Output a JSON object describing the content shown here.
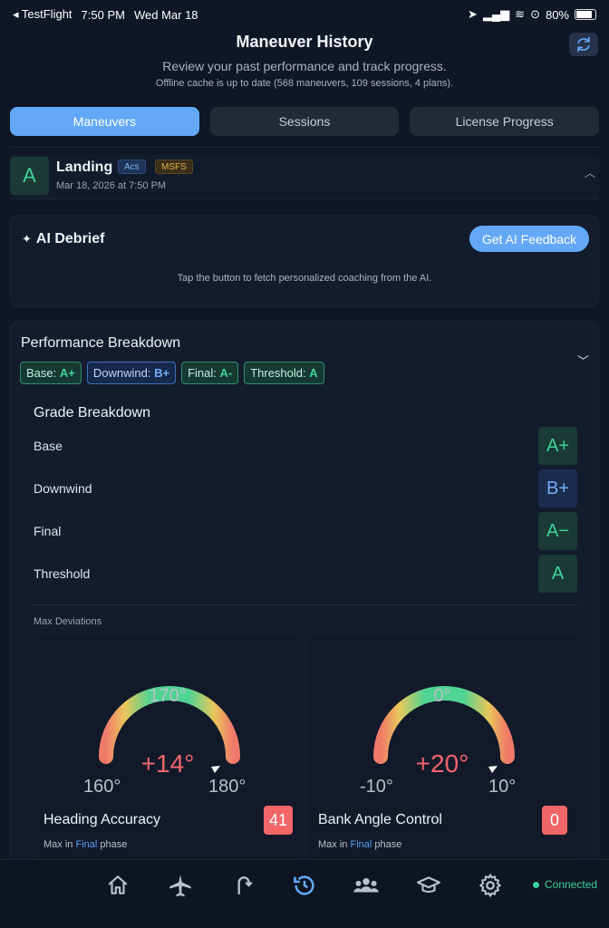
{
  "status_bar": {
    "back_app": "◂ TestFlight",
    "time": "7:50 PM",
    "date": "Wed Mar 18",
    "battery": "80%"
  },
  "header": {
    "title": "Maneuver History",
    "subtitle": "Review your past performance and track progress.",
    "cache_note": "Offline cache is up to date (568 maneuvers, 109 sessions, 4 plans)."
  },
  "tabs": [
    {
      "label": "Maneuvers",
      "active": true
    },
    {
      "label": "Sessions",
      "active": false
    },
    {
      "label": "License Progress",
      "active": false
    }
  ],
  "maneuver": {
    "grade": "A",
    "name": "Landing",
    "badges": [
      "Acs",
      "MSFS"
    ],
    "date": "Mar 18, 2026 at 7:50 PM"
  },
  "debrief": {
    "title": "AI Debrief",
    "button": "Get AI Feedback",
    "hint": "Tap the button to fetch personalized coaching from the AI."
  },
  "performance": {
    "title": "Performance Breakdown",
    "chips": [
      {
        "label": "Base:",
        "grade": "A+"
      },
      {
        "label": "Downwind:",
        "grade": "B+"
      },
      {
        "label": "Final:",
        "grade": "A-"
      },
      {
        "label": "Threshold:",
        "grade": "A"
      }
    ],
    "grade_breakdown_title": "Grade Breakdown",
    "grades": [
      {
        "label": "Base",
        "grade": "A+"
      },
      {
        "label": "Downwind",
        "grade": "B+"
      },
      {
        "label": "Final",
        "grade": "A−"
      },
      {
        "label": "Threshold",
        "grade": "A"
      }
    ],
    "max_deviations_label": "Max Deviations",
    "gauges": [
      {
        "name": "Heading Accuracy",
        "top": "170°",
        "min": "160°",
        "max": "180°",
        "value": "+14°",
        "score": "41",
        "sub_prefix": "Max in",
        "phase": "Final",
        "sub_suffix": "phase"
      },
      {
        "name": "Bank Angle Control",
        "top": "0°",
        "min": "-10°",
        "max": "10°",
        "value": "+20°",
        "score": "0",
        "sub_prefix": "Max in",
        "phase": "Final",
        "sub_suffix": "phase"
      }
    ]
  },
  "nav": {
    "connection": "Connected"
  },
  "colors": {
    "accent": "#63a8f7",
    "good": "#3ed39a",
    "bad": "#f26566"
  }
}
